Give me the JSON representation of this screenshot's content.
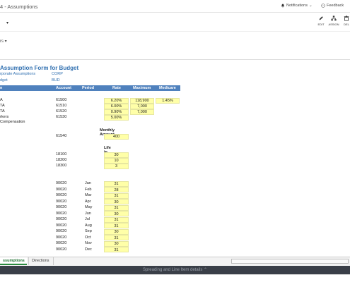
{
  "app": {
    "title": "4 - Assumptions"
  },
  "header": {
    "notifications_label": "Notifications",
    "feedback_label": "Feedback"
  },
  "toolbar": {
    "edit_label": "EDIT",
    "assign_label": "ASSIGN",
    "delete_label": "DEL"
  },
  "subbar": {
    "label": "rs"
  },
  "form": {
    "title": "Assumption Form for Budget",
    "meta": [
      {
        "label": "rporate Assumptions",
        "value": "CORP"
      },
      {
        "label": "dget",
        "value": "BUD"
      }
    ],
    "headers": {
      "col1": "n",
      "account": "Account",
      "period": "Period",
      "rate": "Rate",
      "maximum": "Maximum",
      "medicare": "Medicare"
    },
    "tax_rows": [
      {
        "name": "A",
        "account": "61500",
        "rate": "6.20%",
        "maximum": "118,900",
        "medicare": "1.45%"
      },
      {
        "name": "TA",
        "account": "61510",
        "rate": "6.00%",
        "maximum": "7,000",
        "medicare": ""
      },
      {
        "name": "TA",
        "account": "61520",
        "rate": "0.90%",
        "maximum": "7,000",
        "medicare": ""
      },
      {
        "name": "rkers Compensation",
        "account": "61530",
        "rate": "5.00%",
        "maximum": "",
        "medicare": ""
      }
    ],
    "monthly": {
      "label": "Monthly Amount",
      "account": "61540",
      "value": "400"
    },
    "life": {
      "label": "Life in Years",
      "rows": [
        {
          "account": "18100",
          "value": "30"
        },
        {
          "account": "18200",
          "value": "10"
        },
        {
          "account": "18300",
          "value": "3"
        }
      ]
    },
    "months": [
      {
        "account": "90020",
        "period": "Jan",
        "value": "31"
      },
      {
        "account": "90020",
        "period": "Feb",
        "value": "28"
      },
      {
        "account": "90020",
        "period": "Mar",
        "value": "31"
      },
      {
        "account": "90020",
        "period": "Apr",
        "value": "30"
      },
      {
        "account": "90020",
        "period": "May",
        "value": "31"
      },
      {
        "account": "90020",
        "period": "Jun",
        "value": "30"
      },
      {
        "account": "90020",
        "period": "Jul",
        "value": "31"
      },
      {
        "account": "90020",
        "period": "Aug",
        "value": "31"
      },
      {
        "account": "90020",
        "period": "Sep",
        "value": "30"
      },
      {
        "account": "90020",
        "period": "Oct",
        "value": "31"
      },
      {
        "account": "90020",
        "period": "Nov",
        "value": "30"
      },
      {
        "account": "90020",
        "period": "Dec",
        "value": "31"
      }
    ]
  },
  "tabs": [
    {
      "label": "ssumptions",
      "active": true
    },
    {
      "label": "Directions",
      "active": false
    }
  ],
  "footer": {
    "label": "Spreading and Line Item details"
  },
  "colors": {
    "accent": "#2f6fb0",
    "header_bg": "#4f81bd",
    "input_yellow": "#ffffa8",
    "active_tab": "#2a8a3e",
    "footer_bg": "#3a3f48"
  }
}
